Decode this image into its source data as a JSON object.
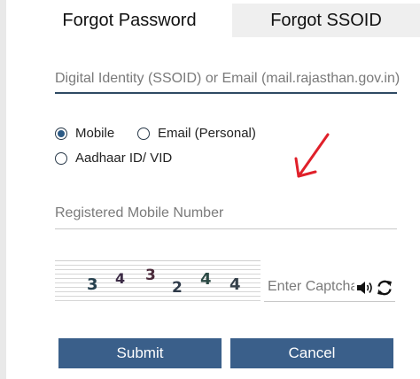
{
  "tabs": [
    {
      "label": "Forgot Password",
      "active": true
    },
    {
      "label": "Forgot SSOID",
      "active": false
    }
  ],
  "identity_field": {
    "placeholder": "Digital Identity (SSOID) or Email (mail.rajasthan.gov.in)",
    "value": ""
  },
  "recovery_options": [
    {
      "label": "Mobile",
      "selected": true
    },
    {
      "label": "Email (Personal)",
      "selected": false
    },
    {
      "label": "Aadhaar ID/ VID",
      "selected": false
    }
  ],
  "mobile_field": {
    "placeholder": "Registered Mobile Number",
    "value": ""
  },
  "captcha": {
    "digits": [
      "3",
      "4",
      "3",
      "2",
      "4",
      "4"
    ],
    "input_placeholder": "Enter Captcha",
    "audio_icon": "speaker-icon",
    "refresh_icon": "refresh-icon"
  },
  "annotation_arrow_color": "#e0202a",
  "buttons": {
    "submit": "Submit",
    "cancel": "Cancel"
  },
  "colors": {
    "button_bg": "#3a5f8a",
    "focus_line": "#2e4a63",
    "radio_selected": "#2c5a85"
  }
}
